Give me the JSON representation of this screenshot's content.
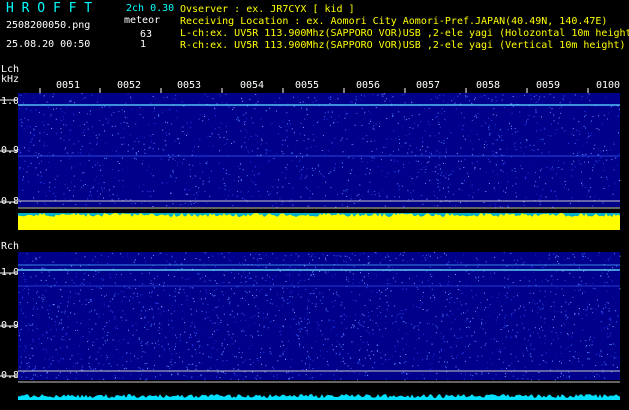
{
  "header": {
    "brand": "H R O F F T",
    "version": "2ch 0.30",
    "filename": "2508200050.png",
    "meteor_label": "meteor",
    "datetime": "25.08.20 00:50",
    "lch_count": "63",
    "rch_count": "1",
    "observer": "Ovserver           : ex. JR7CYX [ kid ]",
    "location": "Receiving Location : ex. Aomori City Aomori-Pref.JAPAN(40.49N, 140.47E)",
    "lch_info": "L-ch:ex. UV5R 113.900Mhz(SAPPORO VOR)USB ,2-ele yagi (Holozontal 10m height",
    "rch_info": "R-ch:ex. UV5R 113.900Mhz(SAPPORO VOR)USB ,2-ele yagi (Vertical 10m height)"
  },
  "time_axis": {
    "labels": [
      "0051",
      "0052",
      "0053",
      "0054",
      "0055",
      "0056",
      "0057",
      "0058",
      "0059",
      "0100"
    ]
  },
  "lch_panel": {
    "channel_label": "Lch",
    "unit_label": "kHz",
    "freq_labels": [
      "1.0",
      "0.9",
      "0.8"
    ]
  },
  "rch_panel": {
    "channel_label": "Rch",
    "freq_labels": [
      "1.0",
      "0.9",
      "0.8"
    ]
  },
  "colors": {
    "background": "#000000",
    "spectrogram_base": "#00008a",
    "lch_level": "#ffff00",
    "rch_level": "#00e0ff",
    "text_white": "#ffffff",
    "text_yellow": "#ffff00",
    "text_cyan": "#00ffff"
  }
}
